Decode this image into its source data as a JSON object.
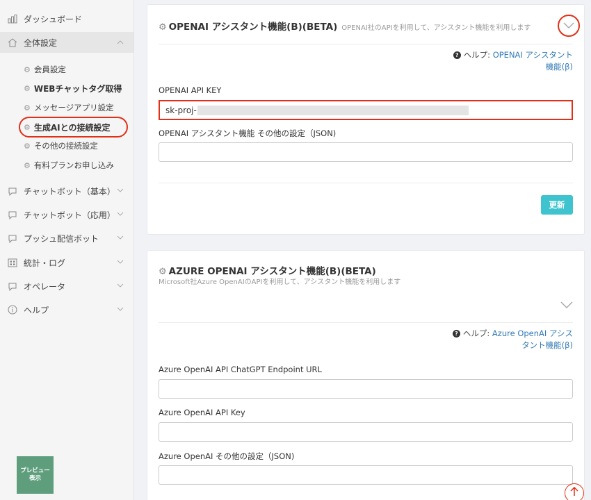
{
  "sidebar": {
    "dashboard": "ダッシュボード",
    "general_settings": "全体設定",
    "sub_items": [
      "会員設定",
      "WEBチャットタグ取得",
      "メッセージアプリ設定",
      "生成AIとの接続設定",
      "その他の接続設定",
      "有料プランお申し込み"
    ],
    "chatbot_basic": "チャットボット（基本）",
    "chatbot_advanced": "チャットボット（応用）",
    "push_bot": "プッシュ配信ボット",
    "stats_log": "統計・ログ",
    "operator": "オペレータ",
    "help": "ヘルプ",
    "preview_line1": "プレビュー",
    "preview_line2": "表示"
  },
  "openai_card": {
    "title": "OPENAI アシスタント機能(B)(BETA)",
    "description": "OPENAI社のAPIを利用して、アシスタント機能を利用します",
    "help_prefix": "ヘルプ:",
    "help_link_line1": "OPENAI アシスタント",
    "help_link_line2": "機能(β)",
    "api_key_label": "OPENAI API KEY",
    "api_key_value": "sk-proj-",
    "json_label": "OPENAI アシスタント機能 その他の設定（JSON)",
    "json_value": "",
    "update_button": "更新"
  },
  "azure_card": {
    "title": "AZURE OPENAI アシスタント機能(B)(BETA)",
    "description": "Microsoft社Azure OpenAIのAPIを利用して、アシスタント機能を利用します",
    "help_prefix": "ヘルプ:",
    "help_link_line1": "Azure OpenAI アシス",
    "help_link_line2": "タント機能(β)",
    "endpoint_label": "Azure OpenAI API ChatGPT Endpoint URL",
    "endpoint_value": "",
    "api_key_label": "Azure OpenAI API Key",
    "api_key_value": "",
    "json_label": "Azure OpenAI その他の設定（JSON)",
    "json_value": ""
  },
  "icons": {
    "dashboard": "bar-chart-icon",
    "home": "home-icon",
    "chat": "chat-bubble-icon",
    "stats": "grid-icon",
    "info": "info-icon",
    "gear": "gear-icon",
    "chevron": "chevron-down-icon",
    "scroll_top": "arrow-up-icon"
  },
  "colors": {
    "accent": "#3fc4cf",
    "highlight": "#e03018",
    "link": "#337ab7",
    "preview": "#5f9e7d"
  }
}
